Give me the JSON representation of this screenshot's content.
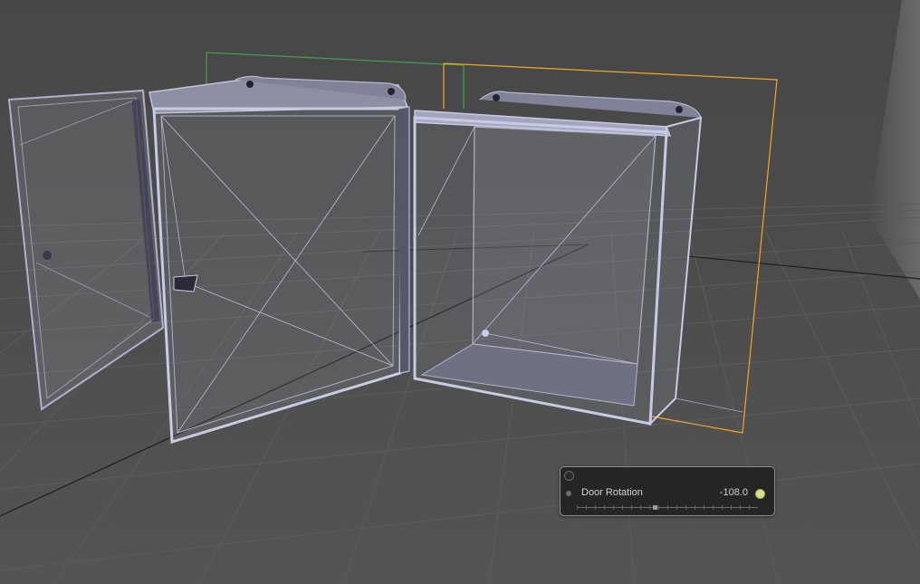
{
  "viewport": {
    "background": "#4b4b4b",
    "wireframe_color": "#aeb6d6",
    "selection_color_primary": "#f5a623",
    "selection_color_secondary": "#3fa34d"
  },
  "hud": {
    "close_icon": "close-circle-icon",
    "parameter": {
      "label": "Door Rotation",
      "value": "-108.0",
      "keyframe_color": "#d7e08a",
      "slider_position": 0.43
    }
  }
}
